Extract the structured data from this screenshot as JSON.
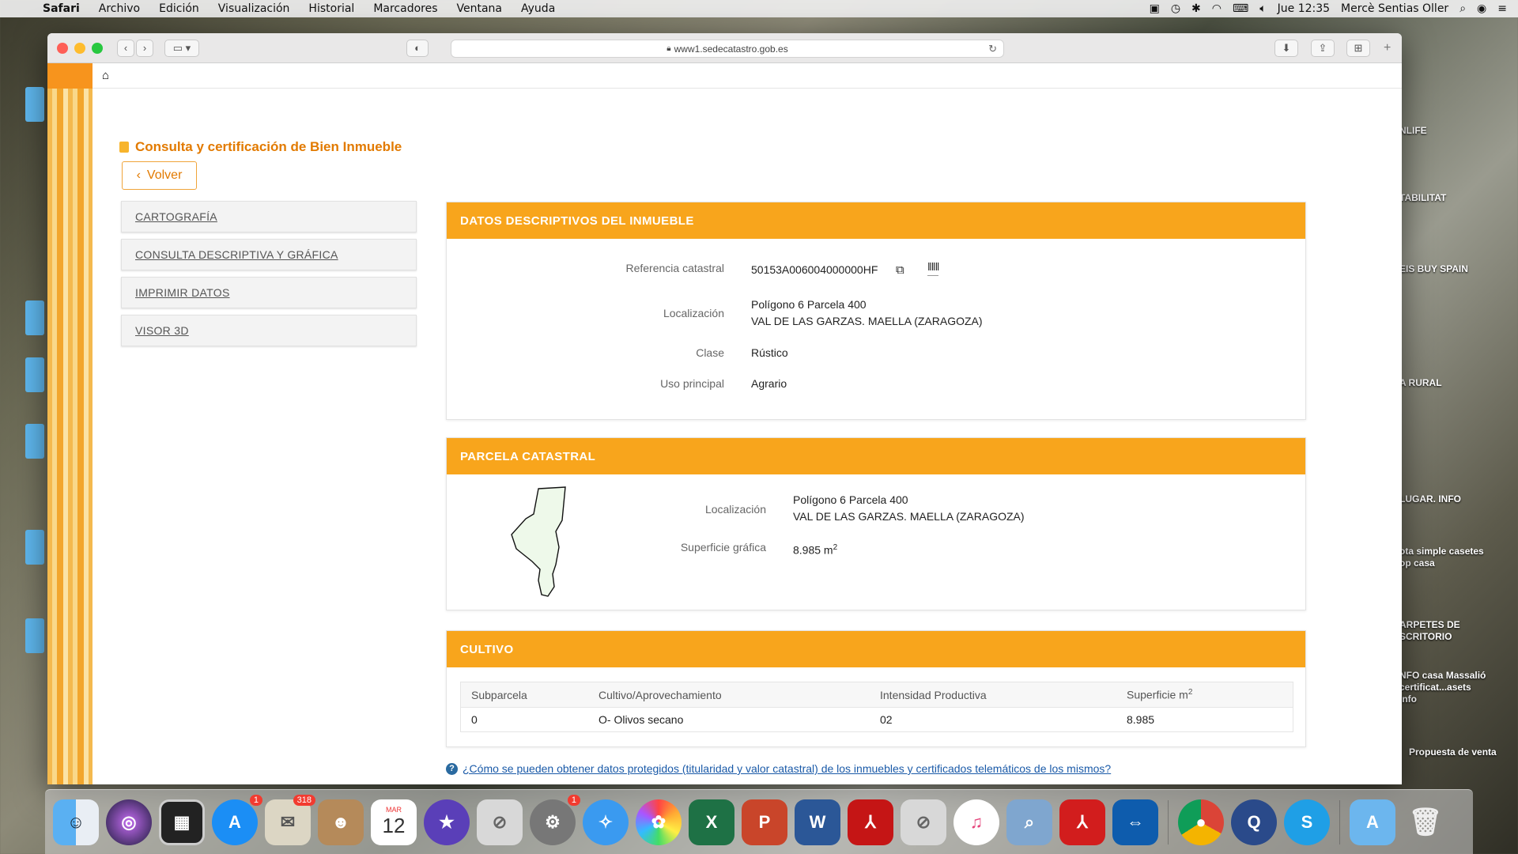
{
  "menubar": {
    "app": "Safari",
    "items": [
      "Archivo",
      "Edición",
      "Visualización",
      "Historial",
      "Marcadores",
      "Ventana",
      "Ayuda"
    ],
    "datetime": "Jue 12:35",
    "user": "Mercè Sentias Oller"
  },
  "desktop": {
    "labels": [
      "NLIFE",
      "TABILITAT",
      "EIS BUY SPAIN",
      "A RURAL",
      "LUGAR. INFO",
      "ota simple casetes op casa",
      "ARPETES DE SCRITORIO",
      "NFO casa Massalió certificat...asets info",
      "Propuesta de venta"
    ]
  },
  "browser": {
    "url": "www1.sedecatastro.gob.es"
  },
  "page": {
    "title": "Consulta y certificación de Bien Inmueble",
    "back_label": "Volver",
    "menu": [
      "CARTOGRAFÍA",
      "CONSULTA DESCRIPTIVA Y GRÁFICA",
      "IMPRIMIR DATOS",
      "VISOR 3D"
    ],
    "datos": {
      "header": "DATOS DESCRIPTIVOS DEL INMUEBLE",
      "ref_label": "Referencia catastral",
      "ref_value": "50153A006004000000HF",
      "loc_label": "Localización",
      "loc_line1": "Polígono 6 Parcela 400",
      "loc_line2": "VAL DE LAS GARZAS. MAELLA (ZARAGOZA)",
      "clase_label": "Clase",
      "clase_value": "Rústico",
      "uso_label": "Uso principal",
      "uso_value": "Agrario"
    },
    "parcela": {
      "header": "PARCELA CATASTRAL",
      "loc_label": "Localización",
      "loc_line1": "Polígono 6 Parcela 400",
      "loc_line2": "VAL DE LAS GARZAS. MAELLA (ZARAGOZA)",
      "sup_label": "Superficie gráfica",
      "sup_value": "8.985 m",
      "sup_exp": "2"
    },
    "cultivo": {
      "header": "CULTIVO",
      "columns": [
        "Subparcela",
        "Cultivo/Aprovechamiento",
        "Intensidad Productiva",
        "Superficie m"
      ],
      "col4_exp": "2",
      "rows": [
        [
          "0",
          "O- Olivos secano",
          "02",
          "8.985"
        ]
      ]
    },
    "help_text": "¿Cómo se pueden obtener datos protegidos (titularidad y valor catastral) de los inmuebles y certificados telemáticos de los mismos?"
  },
  "dock": {
    "badges": {
      "appstore": "1",
      "mail": "318",
      "sysprefs": "1"
    },
    "calendar_month": "MAR",
    "calendar_day": "12"
  }
}
